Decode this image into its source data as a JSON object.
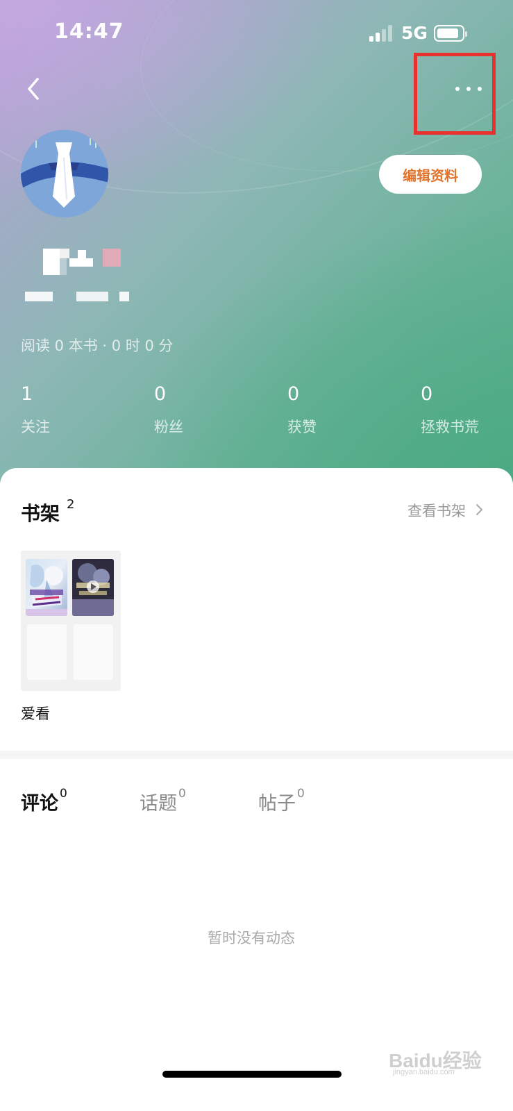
{
  "status_bar": {
    "time": "14:47",
    "network": "5G"
  },
  "nav": {
    "back_icon": "chevron-left-icon",
    "more_icon": "more-dots-icon"
  },
  "profile": {
    "edit_button_label": "编辑资料",
    "reading_stats": "阅读 0 本书 · 0 时 0 分",
    "stats": [
      {
        "value": "1",
        "label": "关注"
      },
      {
        "value": "0",
        "label": "粉丝"
      },
      {
        "value": "0",
        "label": "获赞"
      },
      {
        "value": "0",
        "label": "拯救书荒"
      }
    ]
  },
  "bookshelf": {
    "title": "书架",
    "count": "2",
    "view_all_label": "查看书架",
    "folder_name": "爱看"
  },
  "activity_tabs": [
    {
      "label": "评论",
      "count": "0",
      "active": true
    },
    {
      "label": "话题",
      "count": "0",
      "active": false
    },
    {
      "label": "帖子",
      "count": "0",
      "active": false
    }
  ],
  "empty_state": "暂时没有动态",
  "watermark": {
    "brand": "Baidu经验",
    "domain": "jingyan.baidu.com"
  },
  "colors": {
    "accent": "#e0742c",
    "highlight_box": "#e8322f"
  }
}
